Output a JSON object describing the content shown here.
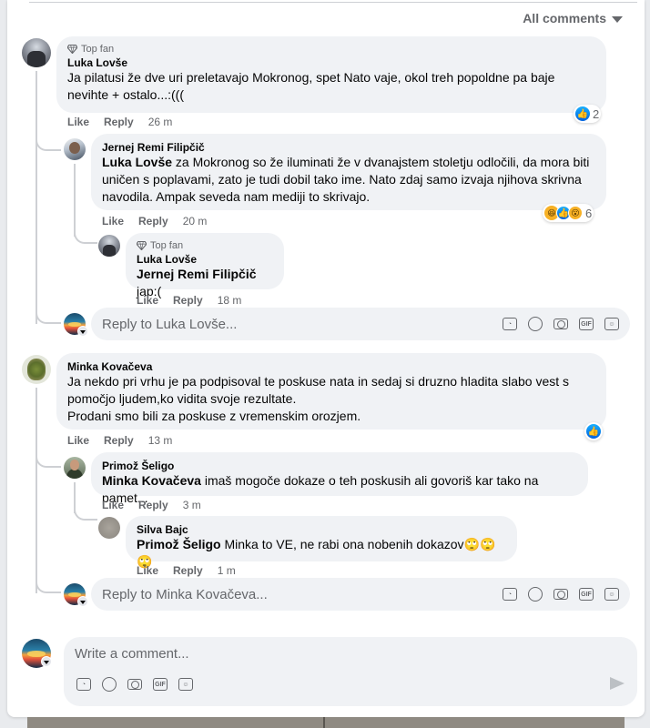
{
  "header": {
    "filter_label": "All comments"
  },
  "colors": {
    "accent": "#0866ff",
    "bubble": "#f0f2f5",
    "secondary_text": "#65676b"
  },
  "comments": [
    {
      "badge": "Top fan",
      "author": "Luka Lovše",
      "text": "Ja pilatusi že dve uri preletavajo Mokronog, spet Nato vaje, okol treh popoldne pa baje nevihte + ostalo...:(((",
      "like": "Like",
      "reply": "Reply",
      "time": "26 m",
      "reaction_count": "2",
      "replies": [
        {
          "author": "Jernej Remi Filipčič",
          "mention": "Luka Lovše",
          "text": " za Mokronog so že iluminati že v dvanajstem stoletju odločili, da mora biti uničen s poplavami, zato je tudi dobil tako ime. Nato zdaj samo izvaja njihova skrivna navodila. Ampak seveda nam mediji to skrivajo.",
          "like": "Like",
          "reply": "Reply",
          "time": "20 m",
          "reaction_count": "6"
        },
        {
          "badge": "Top fan",
          "author": "Luka Lovše",
          "mention": "Jernej Remi Filipčič",
          "text": " jap:(",
          "like": "Like",
          "reply": "Reply",
          "time": "18 m"
        }
      ],
      "reply_placeholder": "Reply to Luka Lovše..."
    },
    {
      "author": "Minka Kovačeva",
      "text": "Ja nekdo pri vrhu je pa podpisoval te poskuse nata in sedaj si druzno hladita slabo vest s pomočjo ljudem,ko vidita svoje rezultate.",
      "text2": "Prodani smo bili za poskuse z vremenskim orozjem.",
      "like": "Like",
      "reply": "Reply",
      "time": "13 m",
      "replies": [
        {
          "author": "Primož Šeligo",
          "mention": "Minka Kovačeva",
          "text": " imaš mogoče dokaze o teh poskusih ali govoriš kar tako na pamet...",
          "like": "Like",
          "reply": "Reply",
          "time": "3 m"
        },
        {
          "author": "Silva Bajc",
          "mention": "Primož Šeligo",
          "text": " Minka to VE, ne rabi ona nobenih dokazov🙄🙄🙄",
          "like": "Like",
          "reply": "Reply",
          "time": "1 m"
        }
      ],
      "reply_placeholder": "Reply to Minka Kovačeva..."
    }
  ],
  "composer": {
    "placeholder": "Write a comment..."
  },
  "tool_icons": [
    "sticker-icon",
    "emoji-icon",
    "camera-icon",
    "gif-icon",
    "avatar-sticker-icon"
  ],
  "gif_label": "GIF"
}
